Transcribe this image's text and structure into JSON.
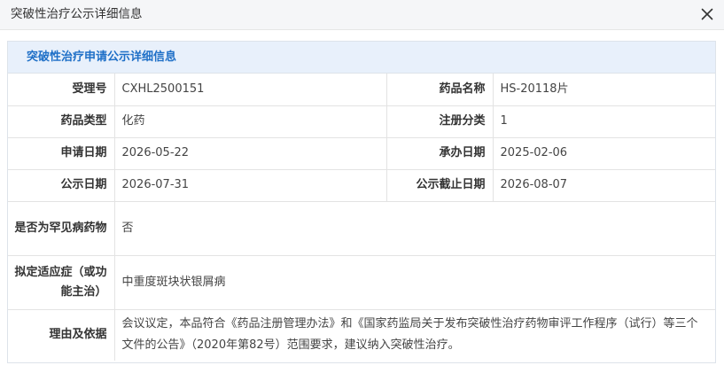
{
  "dialog": {
    "title": "突破性治疗公示详细信息",
    "close_icon": "close-icon"
  },
  "panel": {
    "heading": "突破性治疗申请公示详细信息"
  },
  "fields": {
    "acceptance_no": {
      "label": "受理号",
      "value": "CXHL2500151"
    },
    "drug_name": {
      "label": "药品名称",
      "value": "HS-20118片"
    },
    "drug_type": {
      "label": "药品类型",
      "value": "化药"
    },
    "registration_category": {
      "label": "注册分类",
      "value": "1"
    },
    "application_date": {
      "label": "申请日期",
      "value": "2026-05-22"
    },
    "handling_date": {
      "label": "承办日期",
      "value": "2025-02-06"
    },
    "publicity_date": {
      "label": "公示日期",
      "value": "2026-07-31"
    },
    "publicity_deadline": {
      "label": "公示截止日期",
      "value": "2026-08-07"
    },
    "rare_disease": {
      "label": "是否为罕见病药物",
      "value": "否"
    },
    "indication": {
      "label": "拟定适应症（或功能主治）",
      "value": "中重度斑块状银屑病"
    },
    "reason": {
      "label": "理由及依据",
      "value": "会议议定，本品符合《药品注册管理办法》和《国家药监局关于发布突破性治疗药物审评工作程序（试行）等三个文件的公告》（2020年第82号）范围要求，建议纳入突破性治疗。"
    }
  },
  "colors": {
    "header_bg": "#f5f6f8",
    "panel_head_bg": "#e8f0fb",
    "panel_head_text": "#1e6fc7",
    "border": "#e3e3e3"
  }
}
